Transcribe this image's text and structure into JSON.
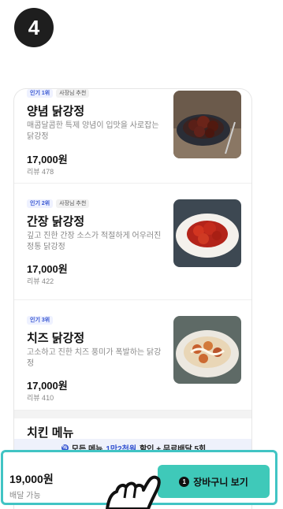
{
  "step": {
    "number": "4"
  },
  "menu": {
    "items": [
      {
        "rank_tag": "인기 1위",
        "owner_tag": "사장님 추천",
        "name": "양념 닭강정",
        "desc": "매콤달콤한 특제 양념이 입맛을 사로잡는 닭강정",
        "price": "17,000원",
        "review": "리뷰 478",
        "image": "yangnyeom-chicken-photo"
      },
      {
        "rank_tag": "인기 2위",
        "owner_tag": "사장님 추천",
        "name": "간장 닭강정",
        "desc": "깊고 진한 간장 소스가 적절하게 어우러진 정통 닭강정",
        "price": "17,000원",
        "review": "리뷰 422",
        "image": "soy-chicken-photo"
      },
      {
        "rank_tag": "인기 3위",
        "owner_tag": "",
        "name": "치즈 닭강정",
        "desc": "고소하고 진한 치즈 풍미가 폭발하는 닭강정",
        "price": "17,000원",
        "review": "리뷰 410",
        "image": "cheese-chicken-photo"
      }
    ],
    "next_section_title": "치킨 메뉴"
  },
  "promo": {
    "prefix": "모든 메뉴",
    "highlight": "1만2천원",
    "suffix": "할인 + 무료배달 5회",
    "icon": "discount-icon"
  },
  "cart": {
    "total": "19,000원",
    "delivery": "배달 가능",
    "count": "1",
    "button_label": "장바구니 보기"
  },
  "colors": {
    "accent": "#3fc9b9",
    "highlight_border": "#41c4c4",
    "brand_blue": "#3554d1",
    "badge": "#1e1e1e"
  }
}
